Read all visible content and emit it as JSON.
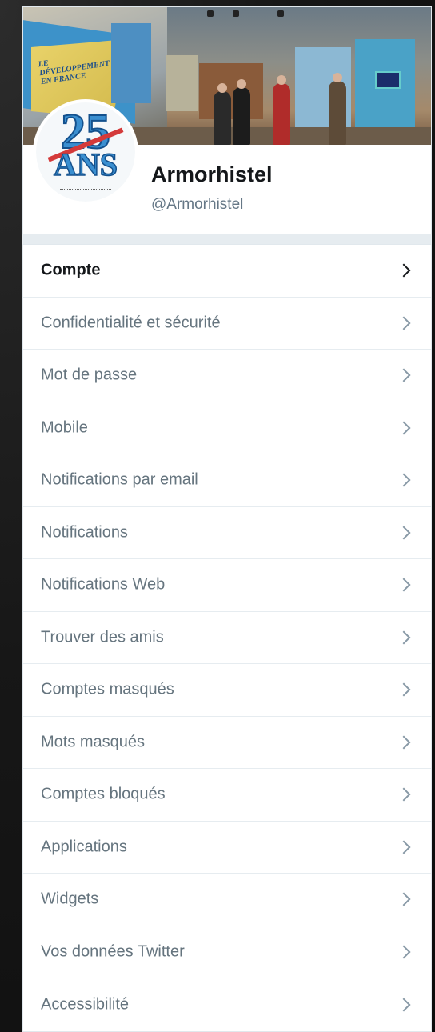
{
  "profile": {
    "name": "Armorhistel",
    "handle": "@Armorhistel",
    "avatar_text_top": "25",
    "avatar_text_bottom": "ANS"
  },
  "banner": {
    "poster_text": "LE DÉVELOPPEMENT EN FRANCE"
  },
  "menu": {
    "items": [
      {
        "label": "Compte",
        "active": true
      },
      {
        "label": "Confidentialité et sécurité"
      },
      {
        "label": "Mot de passe"
      },
      {
        "label": "Mobile"
      },
      {
        "label": "Notifications par email"
      },
      {
        "label": "Notifications"
      },
      {
        "label": "Notifications Web"
      },
      {
        "label": "Trouver des amis"
      },
      {
        "label": "Comptes masqués"
      },
      {
        "label": "Mots masqués"
      },
      {
        "label": "Comptes bloqués"
      },
      {
        "label": "Applications"
      },
      {
        "label": "Widgets"
      },
      {
        "label": "Vos données Twitter"
      },
      {
        "label": "Accessibilité"
      }
    ]
  },
  "icons": {
    "chevron": "chevron-right-icon"
  },
  "colors": {
    "active_text": "#14171a",
    "inactive_text": "#66757f",
    "handle": "#657786",
    "panel_bg": "#e6ecf0"
  }
}
